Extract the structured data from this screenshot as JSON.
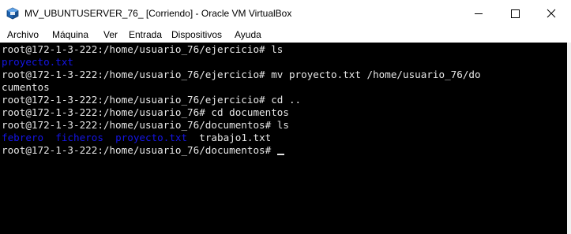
{
  "window": {
    "title": "MV_UBUNTUSERVER_76_ [Corriendo] - Oracle VM VirtualBox",
    "app_icon": "virtualbox-icon",
    "buttons": [
      "minimize-icon",
      "maximize-icon",
      "close-icon"
    ]
  },
  "menu": {
    "items": [
      "Archivo",
      "Máquina",
      "Ver",
      "Entrada",
      "Dispositivos",
      "Ayuda"
    ]
  },
  "terminal": {
    "colors": {
      "background": "#000000",
      "text": "#e6e6e6",
      "directory": "#1515e6"
    },
    "lines": [
      {
        "prompt": "root@172-1-3-222:/home/usuario_76/ejercicio# ",
        "command": "ls"
      },
      {
        "output_dir": "proyecto.txt"
      },
      {
        "prompt": "root@172-1-3-222:/home/usuario_76/ejercicio# ",
        "command": "mv proyecto.txt /home/usuario_76/do"
      },
      {
        "output": "cumentos"
      },
      {
        "prompt": "root@172-1-3-222:/home/usuario_76/ejercicio# ",
        "command": "cd .."
      },
      {
        "prompt": "root@172-1-3-222:/home/usuario_76# ",
        "command": "cd documentos"
      },
      {
        "prompt": "root@172-1-3-222:/home/usuario_76/documentos# ",
        "command": "ls"
      },
      {
        "ls_dirs": [
          "febrero",
          "ficheros",
          "proyecto.txt"
        ],
        "ls_file": "trabajo1.txt"
      },
      {
        "prompt": "root@172-1-3-222:/home/usuario_76/documentos# ",
        "command": ""
      }
    ]
  }
}
